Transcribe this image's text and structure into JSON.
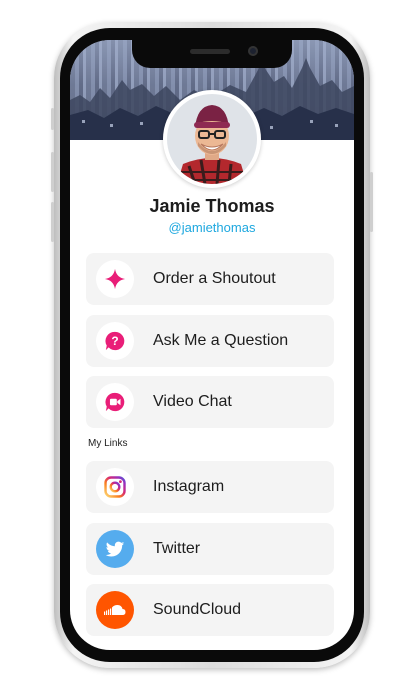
{
  "profile": {
    "name": "Jamie Thomas",
    "handle": "@jamiethomas"
  },
  "actions": [
    {
      "label": "Order a Shoutout",
      "icon": "sparkle-icon"
    },
    {
      "label": "Ask Me a Question",
      "icon": "question-bubble-icon"
    },
    {
      "label": "Video Chat",
      "icon": "video-chat-icon"
    }
  ],
  "links_section_title": "My Links",
  "links": [
    {
      "label": "Instagram",
      "icon": "instagram-icon"
    },
    {
      "label": "Twitter",
      "icon": "twitter-icon"
    },
    {
      "label": "SoundCloud",
      "icon": "soundcloud-icon"
    }
  ],
  "colors": {
    "accent": "#e91e78",
    "handle": "#1ea8df",
    "twitter": "#55acee",
    "soundcloud": "#ff5500",
    "card_bg": "#f4f4f4"
  }
}
